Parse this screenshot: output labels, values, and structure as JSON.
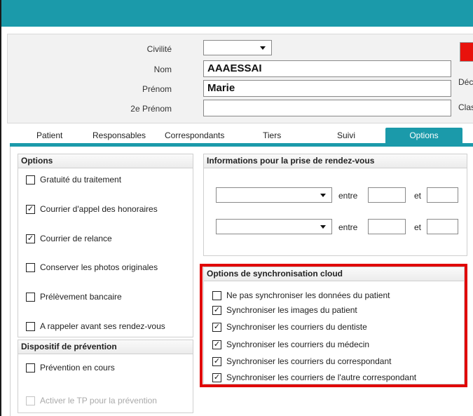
{
  "header": {
    "civilite_label": "Civilité",
    "civilite_value": "",
    "nom_label": "Nom",
    "nom_value": "AAAESSAI",
    "prenom_label": "Prénom",
    "prenom_value": "Marie",
    "prenom2_label": "2e Prénom",
    "prenom2_value": "",
    "side_label_1": "Déc",
    "side_label_2": "Clas"
  },
  "tabs": [
    {
      "label": "Patient"
    },
    {
      "label": "Responsables"
    },
    {
      "label": "Correspondants"
    },
    {
      "label": "Tiers"
    },
    {
      "label": "Suivi"
    },
    {
      "label": "Options",
      "active": true
    }
  ],
  "options": {
    "title": "Options",
    "items": [
      {
        "label": "Gratuité du traitement",
        "checked": false
      },
      {
        "label": "Courrier d'appel des honoraires",
        "checked": true
      },
      {
        "label": "Courrier de relance",
        "checked": true
      },
      {
        "label": "Conserver les photos originales",
        "checked": false
      },
      {
        "label": "Prélèvement bancaire",
        "checked": false
      },
      {
        "label": "A rappeler avant ses rendez-vous",
        "checked": false
      }
    ]
  },
  "prevention": {
    "title": "Dispositif de prévention",
    "items": [
      {
        "label": "Prévention en cours",
        "checked": false,
        "disabled": false
      },
      {
        "label": "Activer le TP pour la prévention",
        "checked": false,
        "disabled": true
      }
    ]
  },
  "rdv": {
    "title": "Informations pour la prise de rendez-vous",
    "between_label": "entre",
    "and_label": "et",
    "rows": [
      {
        "select": "",
        "from": "",
        "to": ""
      },
      {
        "select": "",
        "from": "",
        "to": ""
      }
    ]
  },
  "sync": {
    "title": "Options de synchronisation cloud",
    "items": [
      {
        "label": "Ne pas synchroniser les données du patient",
        "checked": false
      },
      {
        "label": "Synchroniser les images du patient",
        "checked": true
      },
      {
        "label": "Synchroniser les courriers du dentiste",
        "checked": true
      },
      {
        "label": "Synchroniser les courriers du médecin",
        "checked": true
      },
      {
        "label": "Synchroniser les courriers du correspondant",
        "checked": true
      },
      {
        "label": "Synchroniser les courriers de l'autre correspondant",
        "checked": true
      }
    ]
  },
  "colors": {
    "accent": "#1b9aaa",
    "highlight": "#e00000",
    "status_red": "#e8120c"
  },
  "icons": {
    "checkmark": "check-icon",
    "dropdown": "chevron-down-icon"
  }
}
